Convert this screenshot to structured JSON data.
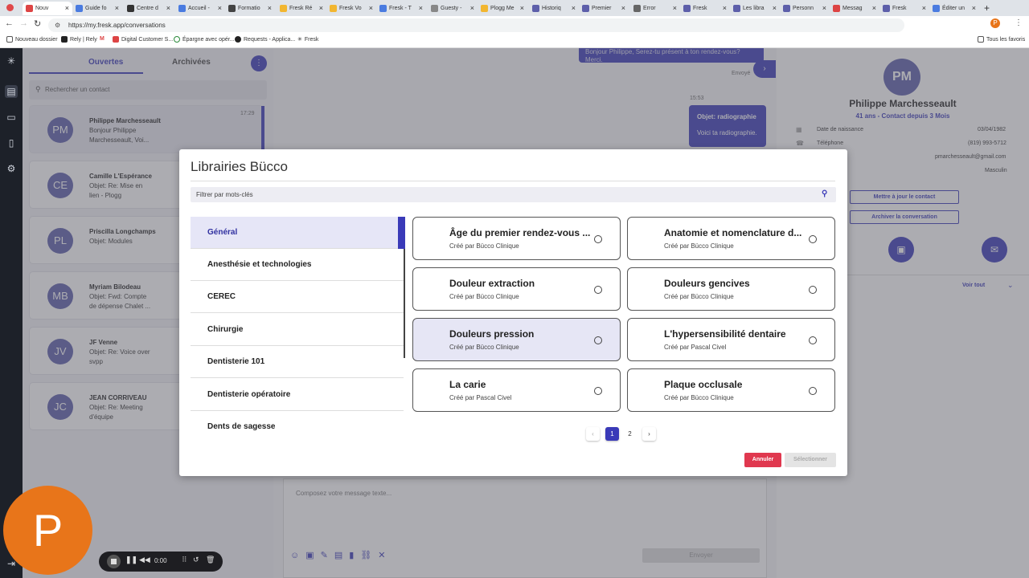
{
  "browser": {
    "tabs": [
      "Nouv",
      "Guide fo",
      "Centre d",
      "Accueil -",
      "Formatio",
      "Fresk Ré",
      "Fresk Vo",
      "Fresk - T",
      "Guesty -",
      "Plogg Me",
      "Historiq",
      "Premier",
      "Error",
      "Fresk",
      "Les libra",
      "Personn",
      "Messag",
      "Fresk",
      "Éditer un"
    ],
    "url": "https://my.fresk.app/conversations",
    "bookmarks": [
      "Nouveau dossier",
      "Rely | Rely",
      "M",
      "Digital Customer S...",
      "Épargne avec opér...",
      "Requests - Applica...",
      "Fresk"
    ],
    "all_bookmarks": "Tous les favoris"
  },
  "leftpane": {
    "tab_open": "Ouvertes",
    "tab_archived": "Archivées",
    "search_placeholder": "Rechercher un contact",
    "contacts": [
      {
        "initials": "PM",
        "name": "Philippe Marchesseault",
        "preview": "Bonjour Philippe Marchesseault, Voi...",
        "time": "17:29"
      },
      {
        "initials": "CE",
        "name": "Camille L'Espérance",
        "preview": "Objet: Re: Mise en lien - Plogg",
        "time": ""
      },
      {
        "initials": "PL",
        "name": "Priscilla Longchamps",
        "preview": "Objet: Modules",
        "time": ""
      },
      {
        "initials": "MB",
        "name": "Myriam Bilodeau",
        "preview": "Objet: Fwd: Compte de dépense Chalet ...",
        "time": ""
      },
      {
        "initials": "JV",
        "name": "JF Venne",
        "preview": "Objet: Re: Voice over svpp",
        "time": ""
      },
      {
        "initials": "JC",
        "name": "JEAN CORRIVEAU",
        "preview": "Objet: Re: Meeting d'équipe",
        "time": ""
      }
    ]
  },
  "chat": {
    "bubble1": "Bonjour Philippe, Serez-tu présent à ton rendez-vous? Merci.",
    "sent_label": "Envoyé",
    "time2": "15:53",
    "subject": "Objet: radiographie",
    "body": "Voici ta radiographie.",
    "composer_placeholder": "Composez votre message texte...",
    "send": "Envoyer"
  },
  "contact_panel": {
    "initials": "PM",
    "name": "Philippe Marchesseault",
    "meta": "41 ans - Contact depuis 3 Mois",
    "dob_label": "Date de naissance",
    "dob": "03/04/1982",
    "phone_label": "Téléphone",
    "phone": "(819) 993-5712",
    "email": "pmarchesseault@gmail.com",
    "gender": "Masculin",
    "update_btn": "Mettre à jour le contact",
    "archive_btn": "Archiver la conversation",
    "see_all": "Voir tout"
  },
  "modal": {
    "title": "Librairies Bücco",
    "filter_placeholder": "Filtrer par mots-clés",
    "categories": [
      "Général",
      "Anesthésie et technologies",
      "CEREC",
      "Chirurgie",
      "Dentisterie 101",
      "Dentisterie opératoire",
      "Dents de sagesse"
    ],
    "cards": [
      {
        "title": "Âge du premier rendez-vous ...",
        "author": "Créé par Bücco Clinique"
      },
      {
        "title": "Anatomie et nomenclature d...",
        "author": "Créé par Bücco Clinique"
      },
      {
        "title": "Douleur extraction",
        "author": "Créé par Bücco Clinique"
      },
      {
        "title": "Douleurs gencives",
        "author": "Créé par Bücco Clinique"
      },
      {
        "title": "Douleurs pression",
        "author": "Créé par Bücco Clinique"
      },
      {
        "title": "L'hypersensibilité dentaire",
        "author": "Créé par Pascal Civel"
      },
      {
        "title": "La carie",
        "author": "Créé par Pascal Civel"
      },
      {
        "title": "Plaque occlusale",
        "author": "Créé par Bücco Clinique"
      }
    ],
    "pages": [
      "1",
      "2"
    ],
    "cancel": "Annuler",
    "select": "Sélectionner"
  },
  "recorder": {
    "avatar": "P",
    "time": "0:00"
  },
  "colors": {
    "primary": "#3a3ab8",
    "danger": "#e0384f",
    "avatar": "#5d5faa"
  }
}
